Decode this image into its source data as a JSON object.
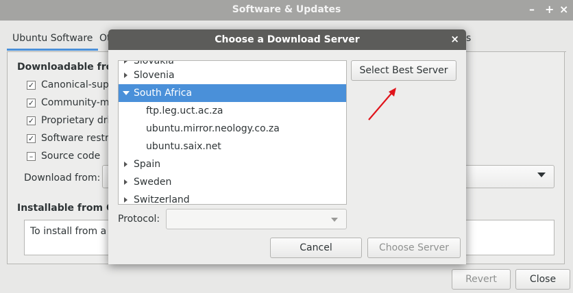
{
  "main_window": {
    "title": "Software & Updates",
    "controls": {
      "minimize": "–",
      "maximize": "+",
      "close": "×"
    },
    "tabs": {
      "active": "Ubuntu Software",
      "partial": "Ot",
      "right_fragment": "s"
    },
    "downloadable_heading": "Downloadable from",
    "checkboxes": [
      {
        "label": "Canonical-suppo",
        "mark": "✓"
      },
      {
        "label": "Community-mai",
        "mark": "✓"
      },
      {
        "label": "Proprietary drive",
        "mark": "✓"
      },
      {
        "label": "Software restric",
        "mark": "✓"
      },
      {
        "label": "Source code",
        "mark": "–"
      }
    ],
    "download_from_label": "Download from:",
    "installable_heading": "Installable from CD",
    "cd_text": "To install from a C",
    "buttons": {
      "revert": "Revert",
      "close": "Close"
    }
  },
  "dialog": {
    "title": "Choose a Download Server",
    "close": "×",
    "tree": [
      {
        "label": "Slovakia",
        "type": "country",
        "state": "collapsed",
        "partial": true
      },
      {
        "label": "Slovenia",
        "type": "country",
        "state": "collapsed"
      },
      {
        "label": "South Africa",
        "type": "country",
        "state": "expanded",
        "selected": true
      },
      {
        "label": "ftp.leg.uct.ac.za",
        "type": "server"
      },
      {
        "label": "ubuntu.mirror.neology.co.za",
        "type": "server"
      },
      {
        "label": "ubuntu.saix.net",
        "type": "server"
      },
      {
        "label": "Spain",
        "type": "country",
        "state": "collapsed"
      },
      {
        "label": "Sweden",
        "type": "country",
        "state": "collapsed"
      },
      {
        "label": "Switzerland",
        "type": "country",
        "state": "collapsed"
      }
    ],
    "select_best_button": "Select Best Server",
    "protocol_label": "Protocol:",
    "protocol_value": "",
    "buttons": {
      "cancel": "Cancel",
      "choose": "Choose Server"
    },
    "annotation_color": "#e0141b"
  }
}
